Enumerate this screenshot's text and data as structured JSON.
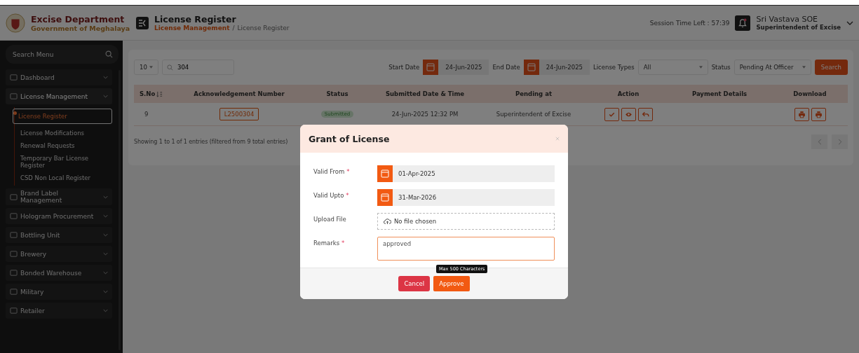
{
  "header": {
    "org_title": "Excise Department",
    "org_subtitle": "Government of Meghalaya",
    "page_title": "License Register",
    "breadcrumb": [
      {
        "label": "License Management",
        "selected": false
      },
      {
        "label": "License Register",
        "selected": true
      }
    ],
    "breadcrumb_separator": "/",
    "session": "Session Time Left : 57:39",
    "user_name": "Sri Vastava SOE",
    "user_role": "Superintendent of Excise"
  },
  "sidebar": {
    "search_placeholder": "Search Menu",
    "items": [
      {
        "label": "Dashboard",
        "expanded": false
      },
      {
        "label": "License Management",
        "expanded": true,
        "children": [
          {
            "label": "License Register",
            "selected": true
          },
          {
            "label": "License Modifications",
            "selected": false
          },
          {
            "label": "Renewal Requests",
            "selected": false
          },
          {
            "label": "Temporary Bar License Register",
            "selected": false
          },
          {
            "label": "CSD Non Local Register",
            "selected": false
          }
        ]
      },
      {
        "label": "Brand Label Management",
        "expanded": false
      },
      {
        "label": "Hologram Procurement",
        "expanded": false
      },
      {
        "label": "Bottling Unit",
        "expanded": false
      },
      {
        "label": "Brewery",
        "expanded": false
      },
      {
        "label": "Bonded Warehouse",
        "expanded": false
      },
      {
        "label": "Military",
        "expanded": false
      },
      {
        "label": "Retailer",
        "expanded": false
      }
    ]
  },
  "filters": {
    "page_size": "10",
    "search_value": "304",
    "start_date_label": "Start Date",
    "start_date": "24-Jun-2025",
    "end_date_label": "End Date",
    "end_date": "24-Jun-2025",
    "license_types_label": "License Types",
    "license_types": "All",
    "status_label": "Status",
    "status": "Pending At Officer",
    "search_button": "Search"
  },
  "table": {
    "columns": [
      "S.No",
      "Acknowledgement Number",
      "Status",
      "Submitted Date & Time",
      "Pending at",
      "Action",
      "Payment Details",
      "Download"
    ],
    "rows": [
      {
        "sno": "9",
        "ack": "L2500304",
        "status": "Submitted",
        "submitted": "24-Jun-2025 12:32 PM",
        "pending_at": "Superintendent of Excise"
      }
    ],
    "info": "Showing 1 to 1 of 1 entries (filtered from 9 total entries)"
  },
  "modal": {
    "title": "Grant of License",
    "fields": [
      {
        "kind": "date",
        "label": "Valid From",
        "mark": "*",
        "value": "01-Apr-2025"
      },
      {
        "kind": "date",
        "label": "Valid Upto",
        "mark": "*",
        "value": "31-Mar-2026"
      },
      {
        "kind": "file",
        "label": "Upload File",
        "value": "No file chosen"
      },
      {
        "kind": "textarea",
        "label": "Remarks",
        "mark": "*",
        "value": "approved"
      }
    ],
    "tooltip": "Max 500 Characters",
    "cancel": "Cancel",
    "approve": "Approve"
  }
}
